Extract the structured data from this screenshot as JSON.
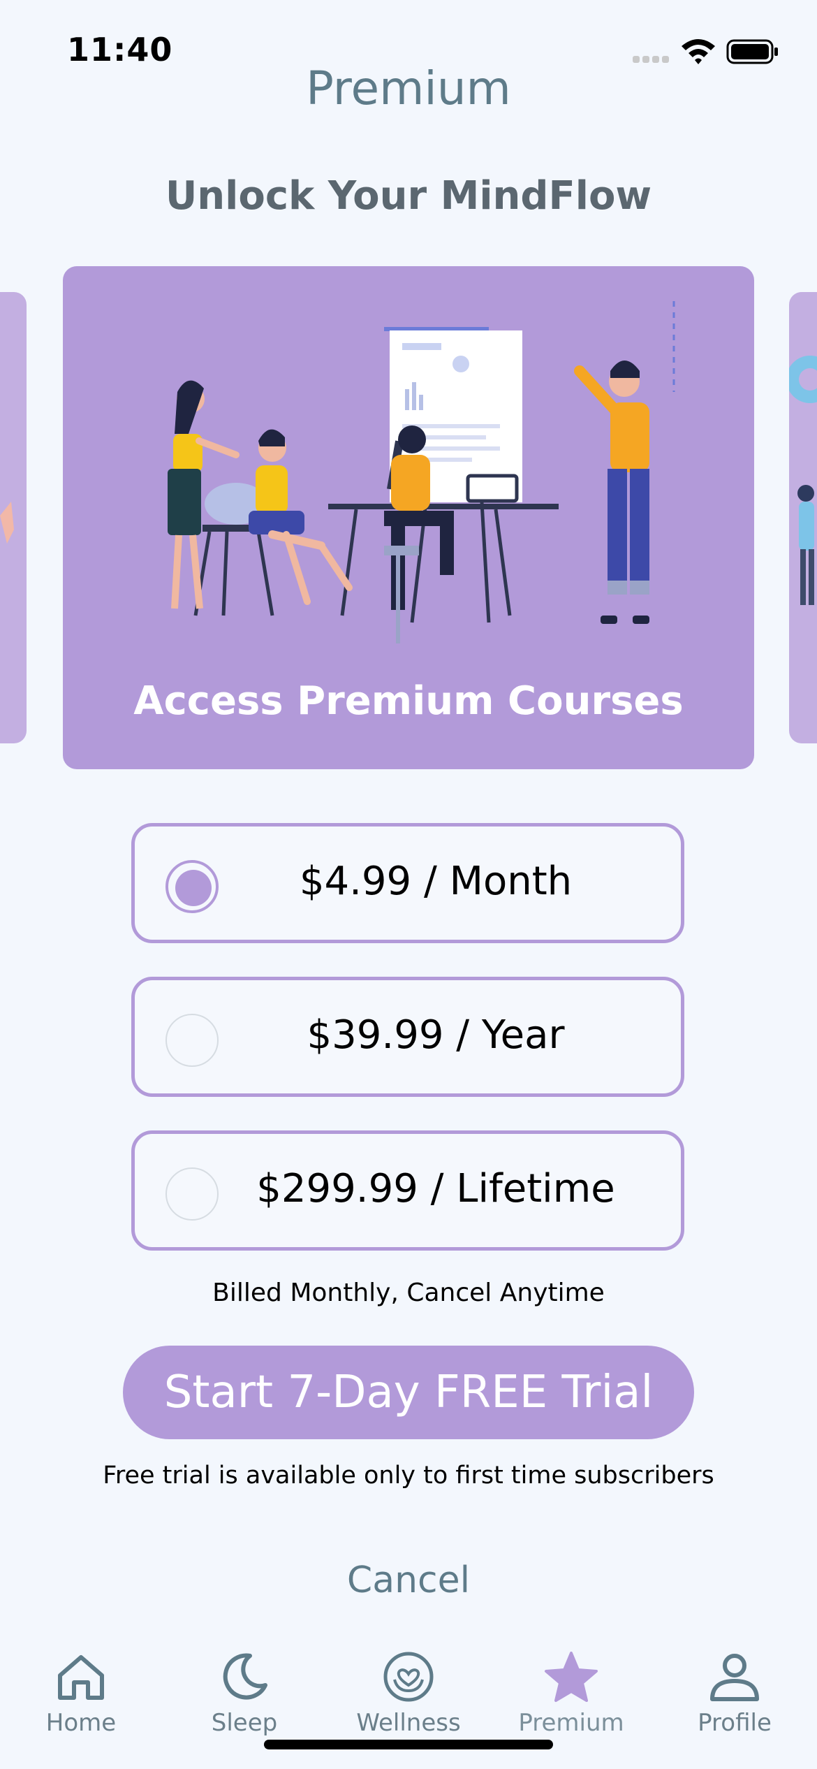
{
  "status_bar": {
    "time": "11:40"
  },
  "header": {
    "title": "Premium",
    "subtitle": "Unlock Your MindFlow"
  },
  "carousel": {
    "active_caption": "Access Premium Courses"
  },
  "plans": [
    {
      "label": "$4.99 / Month",
      "selected": true
    },
    {
      "label": "$39.99 / Year",
      "selected": false
    },
    {
      "label": "$299.99 / Lifetime",
      "selected": false
    }
  ],
  "billing_note": "Billed Monthly, Cancel Anytime",
  "cta": {
    "label": "Start 7-Day FREE Trial",
    "note": "Free trial is available only to first time subscribers"
  },
  "cancel_label": "Cancel",
  "tabs": [
    {
      "label": "Home",
      "icon": "house-icon"
    },
    {
      "label": "Sleep",
      "icon": "moon-icon"
    },
    {
      "label": "Wellness",
      "icon": "heart-hands-icon"
    },
    {
      "label": "Premium",
      "icon": "star-icon",
      "active": true
    },
    {
      "label": "Profile",
      "icon": "person-icon"
    }
  ],
  "colors": {
    "accent": "#b29ad9",
    "title": "#5e7b89",
    "background": "#f3f7fd"
  }
}
